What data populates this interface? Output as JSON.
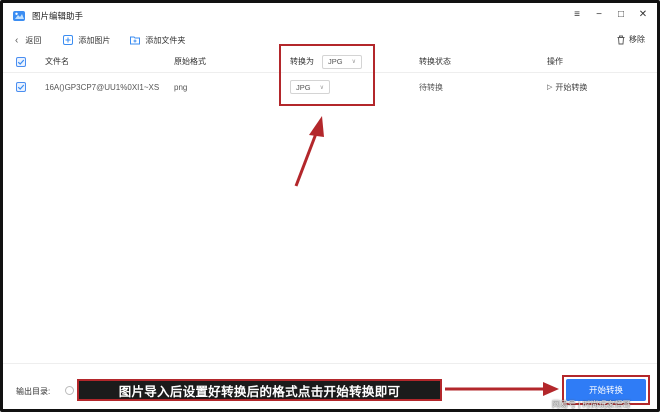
{
  "app": {
    "title": "图片编辑助手"
  },
  "window_controls": {
    "menu": "≡",
    "minimize": "−",
    "maximize": "□",
    "close": "✕"
  },
  "toolbar": {
    "back_label": "返回",
    "add_image_label": "添加图片",
    "add_folder_label": "添加文件夹",
    "remove_label": "移除"
  },
  "table": {
    "headers": {
      "name": "文件名",
      "original_format": "原始格式",
      "convert_to": "转换为",
      "status": "转换状态",
      "action": "操作"
    },
    "header_convert_value": "JPG",
    "rows": [
      {
        "name": "16A()GP3CP7@UU1%0XI1~XS",
        "original_format": "png",
        "convert_to": "JPG",
        "status": "待转换",
        "action": "开始转换",
        "checked": true
      }
    ]
  },
  "bottom": {
    "output_label": "输出目录:",
    "start_button": "开始转换"
  },
  "annotation": {
    "caption": "图片导入后设置好转换后的格式点击开始转换即可",
    "color": "#b3272b"
  },
  "watermark": "网易号 | 时尚玩家悟哥",
  "colors": {
    "primary": "#2f7cf6",
    "annotation_red": "#b3272b"
  }
}
